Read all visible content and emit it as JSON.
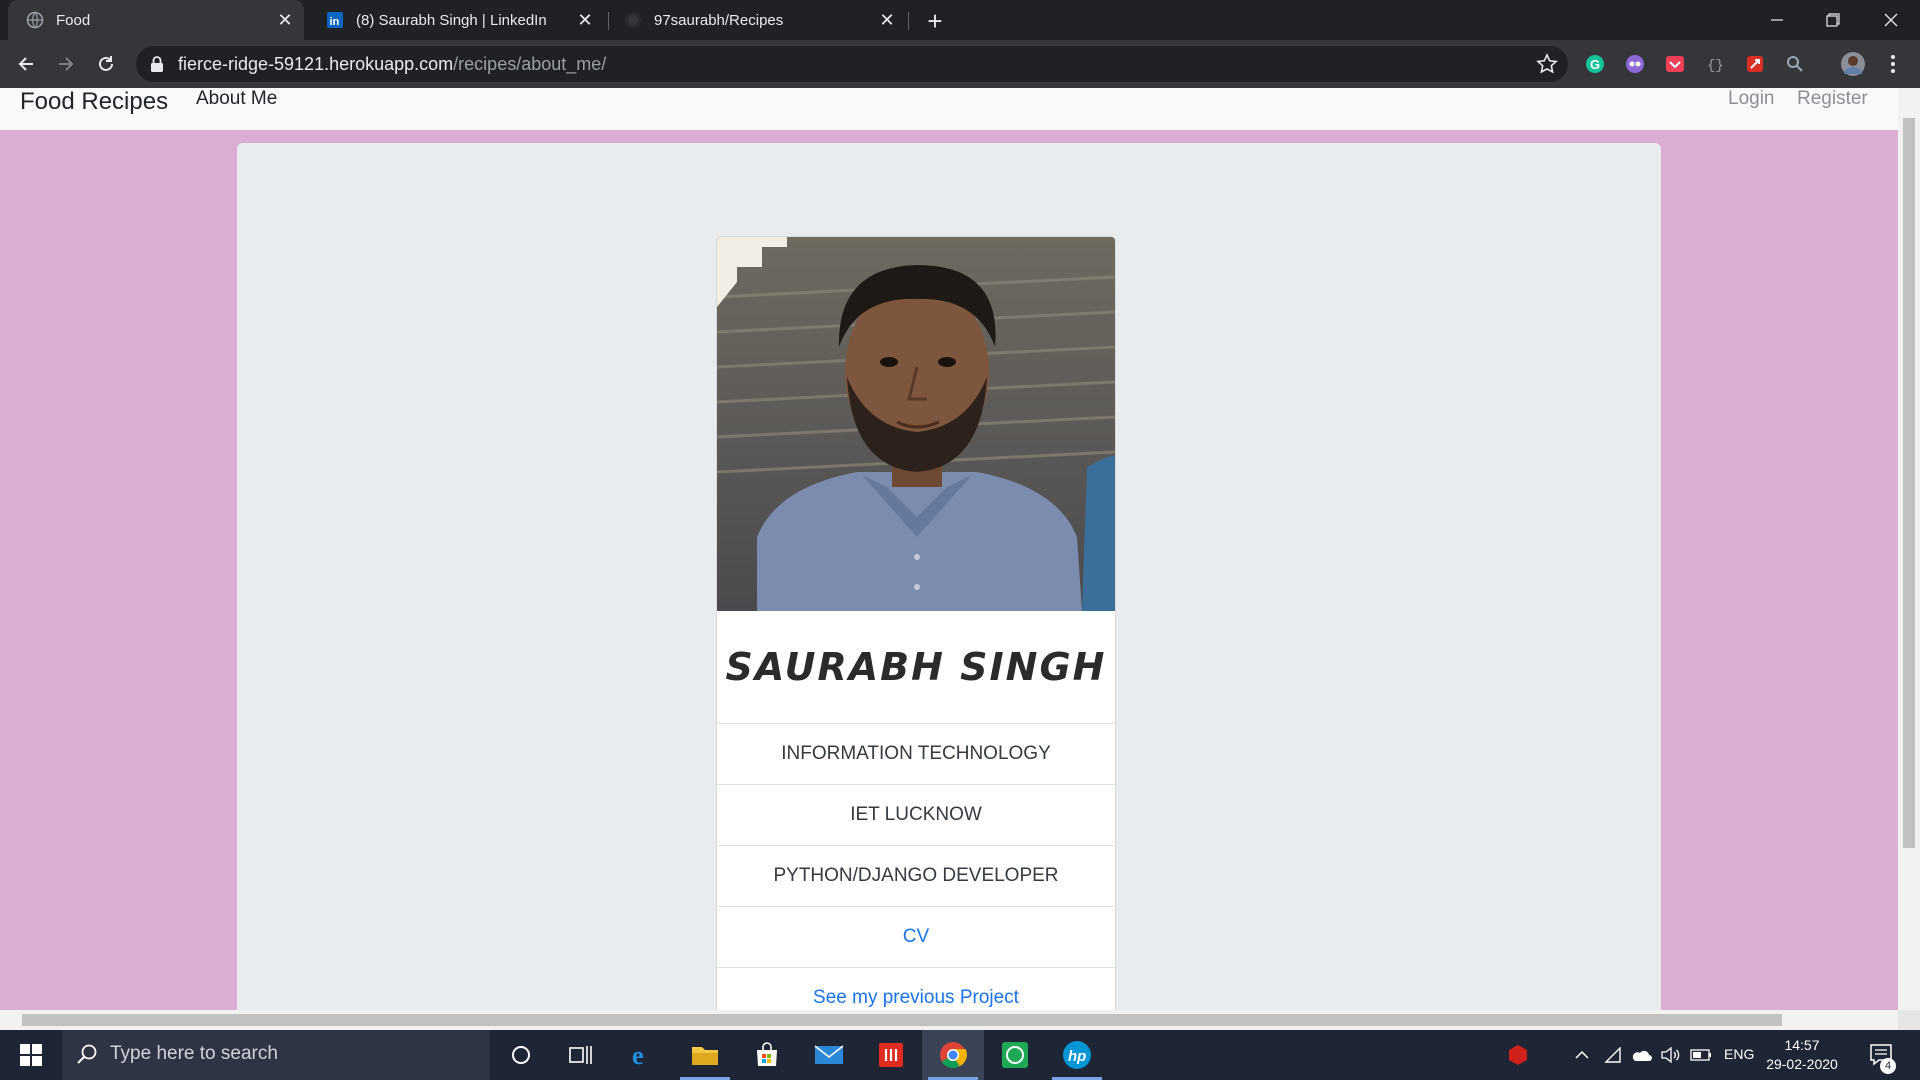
{
  "browser": {
    "tabs": [
      {
        "title": "Food",
        "favicon": "globe-icon",
        "active": true
      },
      {
        "title": "(8) Saurabh Singh | LinkedIn",
        "favicon": "linkedin-icon",
        "active": false
      },
      {
        "title": "97saurabh/Recipes",
        "favicon": "github-icon",
        "active": false
      }
    ],
    "url_host": "fierce-ridge-59121.herokuapp.com",
    "url_path": "/recipes/about_me/"
  },
  "site": {
    "brand": "Food Recipes",
    "nav_about": "About Me",
    "nav_login": "Login",
    "nav_register": "Register"
  },
  "profile": {
    "name": "SAURABH SINGH",
    "items": [
      {
        "text": "INFORMATION TECHNOLOGY",
        "link": false
      },
      {
        "text": "IET LUCKNOW",
        "link": false
      },
      {
        "text": "PYTHON/DJANGO DEVELOPER",
        "link": false
      },
      {
        "text": "CV",
        "link": true
      },
      {
        "text": "See my previous Project",
        "link": true
      }
    ]
  },
  "taskbar": {
    "search_placeholder": "Type here to search",
    "lang": "ENG",
    "time": "14:57",
    "date": "29-02-2020",
    "notifications": "4"
  },
  "colors": {
    "page_bg": "#dcadd2",
    "jumbotron": "#e9ecef",
    "link": "#1a73e8"
  }
}
